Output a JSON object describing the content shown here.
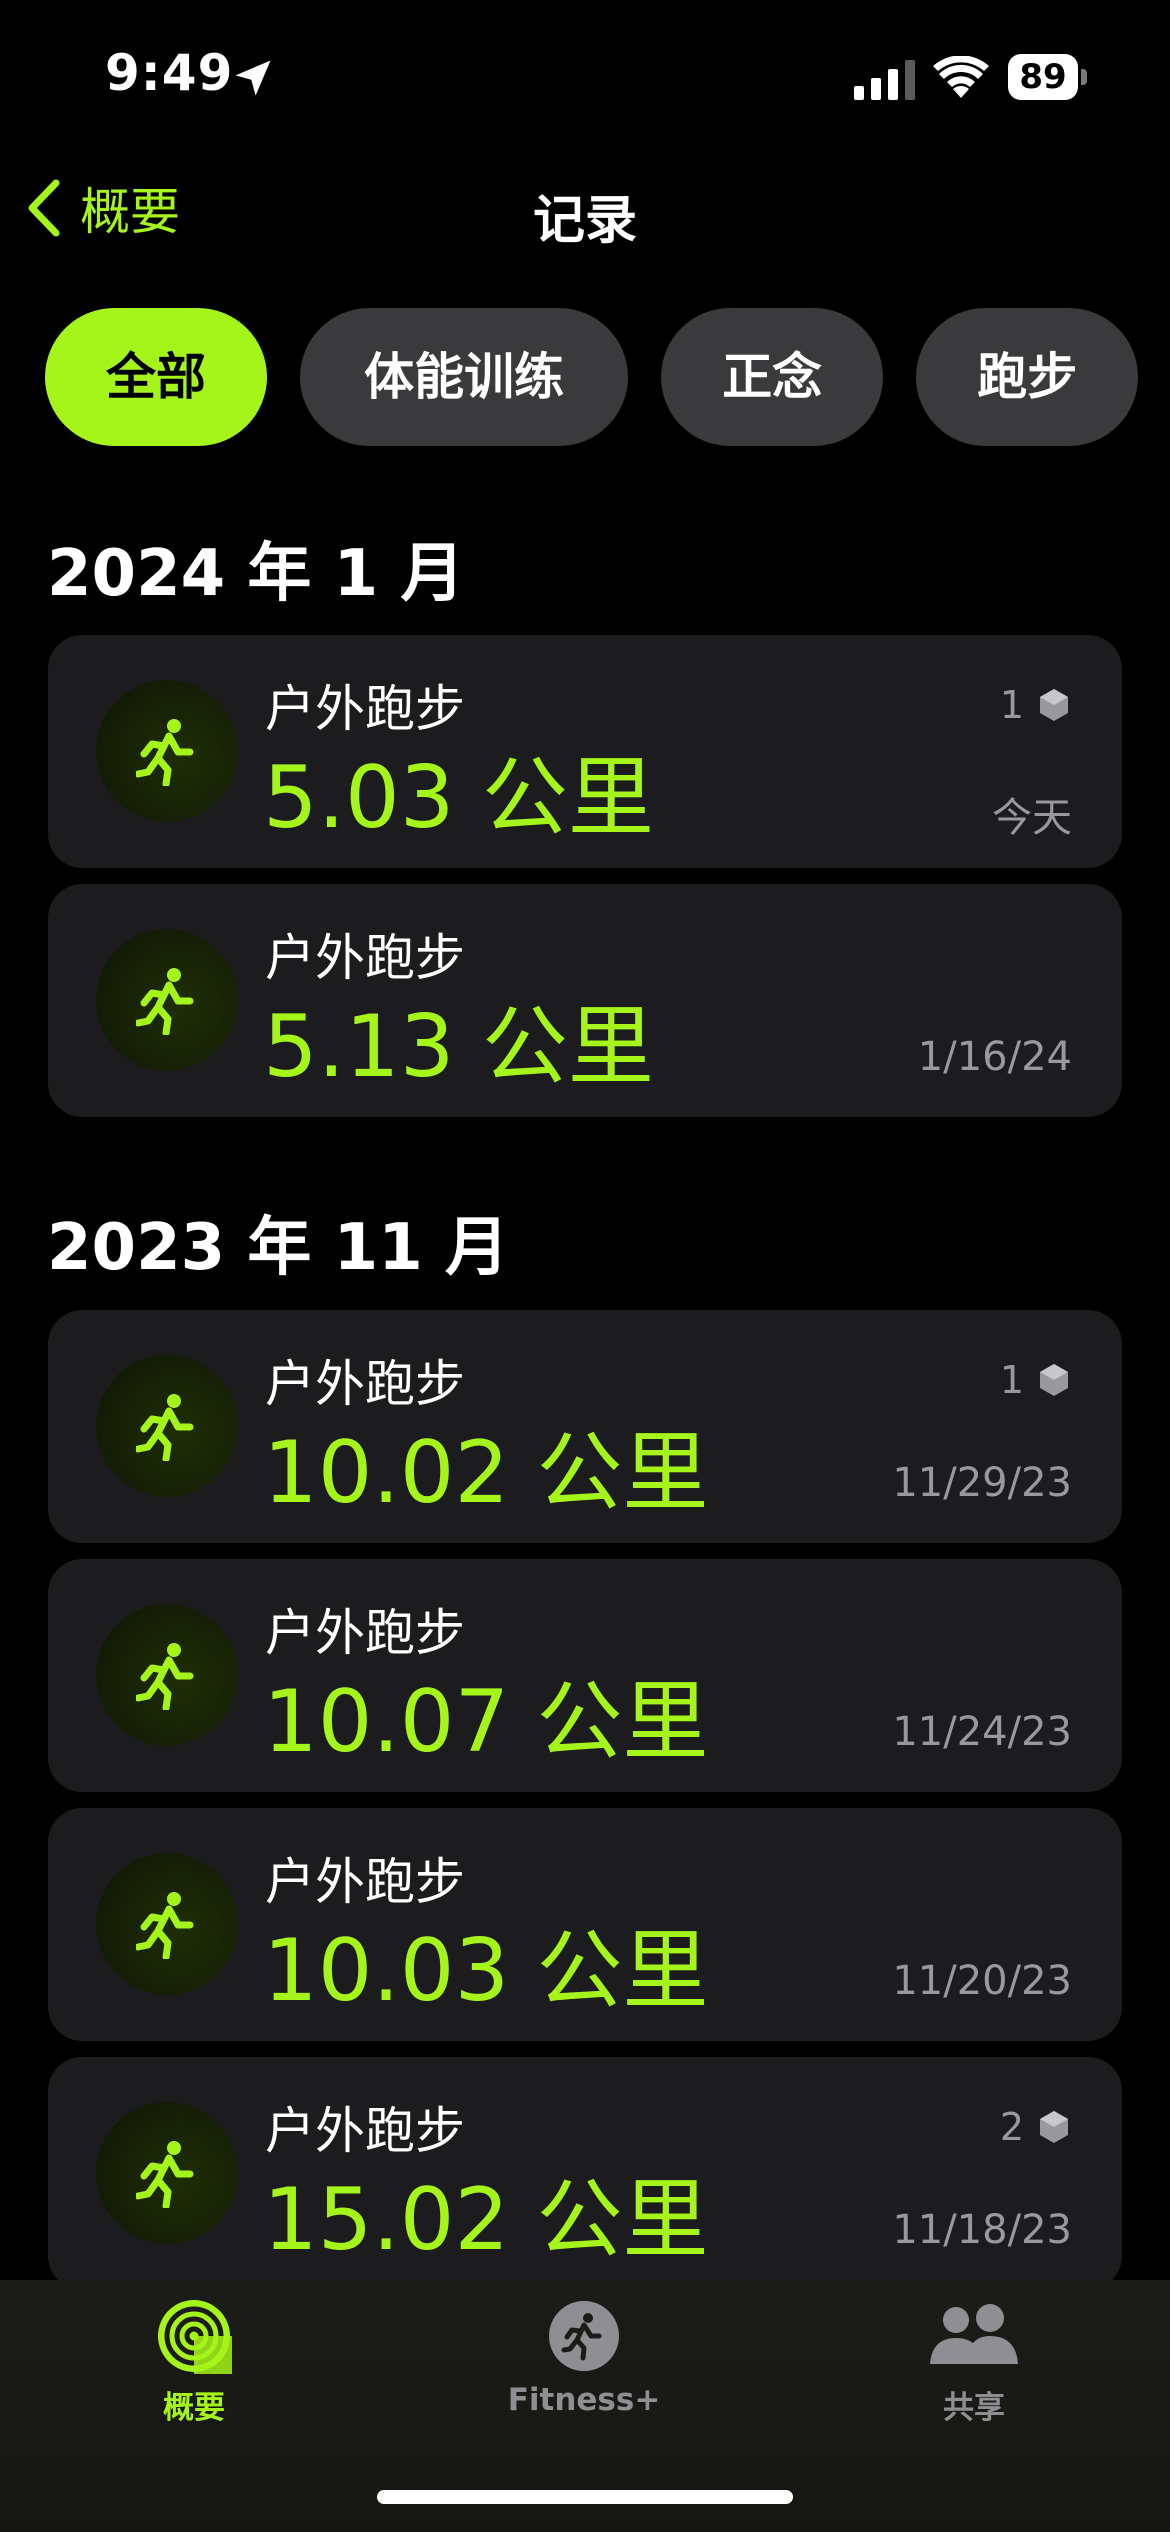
{
  "status_bar": {
    "time": "9:49",
    "battery": "89"
  },
  "nav": {
    "back_label": "概要",
    "title": "记录"
  },
  "filters": [
    {
      "label": "全部",
      "active": true
    },
    {
      "label": "体能训练",
      "active": false
    },
    {
      "label": "正念",
      "active": false
    },
    {
      "label": "跑步",
      "active": false
    }
  ],
  "sections": [
    {
      "title": "2024 年 1 月",
      "workouts": [
        {
          "type": "户外跑步",
          "distance": "5.03 公里",
          "award_count": "1",
          "date": "今天"
        },
        {
          "type": "户外跑步",
          "distance": "5.13 公里",
          "award_count": "",
          "date": "1/16/24"
        }
      ]
    },
    {
      "title": "2023 年 11 月",
      "workouts": [
        {
          "type": "户外跑步",
          "distance": "10.02 公里",
          "award_count": "1",
          "date": "11/29/23"
        },
        {
          "type": "户外跑步",
          "distance": "10.07 公里",
          "award_count": "",
          "date": "11/24/23"
        },
        {
          "type": "户外跑步",
          "distance": "10.03 公里",
          "award_count": "",
          "date": "11/20/23"
        },
        {
          "type": "户外跑步",
          "distance": "15.02 公里",
          "award_count": "2",
          "date": "11/18/23"
        }
      ]
    }
  ],
  "tab_bar": {
    "summary": {
      "label": "概要",
      "icon": "activity-rings-icon"
    },
    "fitness": {
      "label": "Fitness+",
      "icon": "fitness-plus-icon"
    },
    "sharing": {
      "label": "共享",
      "icon": "people-icon"
    }
  },
  "colors": {
    "accent": "#a6f51a",
    "card": "#1c1c1e",
    "chip": "#3a3a3c",
    "secondary_text": "#98989d"
  }
}
